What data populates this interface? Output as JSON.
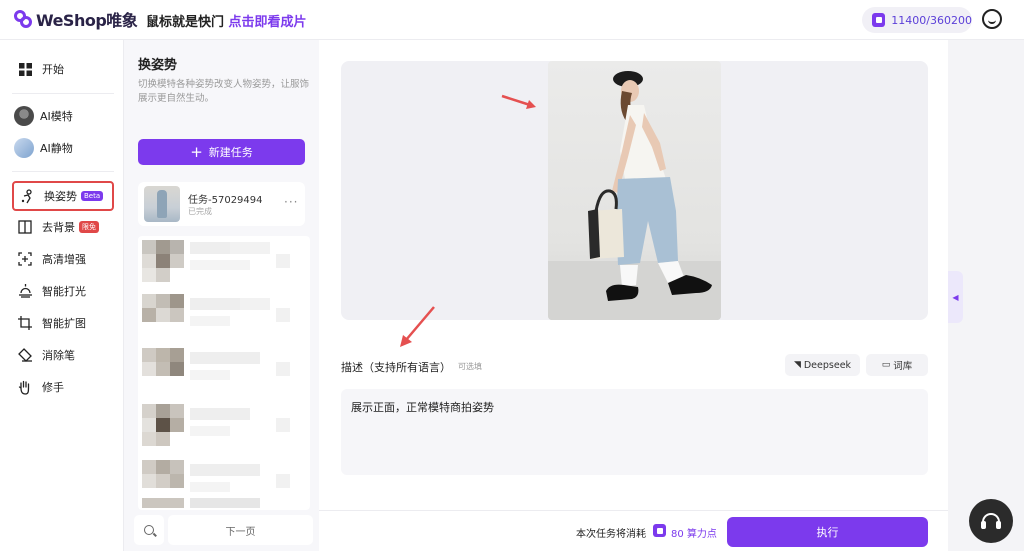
{
  "header": {
    "logo_text": "WeShop唯象",
    "slogan_prefix": "鼠标就是快门",
    "slogan_highlight": "点击即看成片",
    "credits": "11400/360200",
    "accent_color": "#7c3aed"
  },
  "nav": {
    "items": [
      {
        "label": "开始",
        "icon": "grid-icon"
      },
      {
        "label": "AI模特",
        "icon": "model-avatar"
      },
      {
        "label": "AI静物",
        "icon": "still-life-avatar"
      },
      {
        "label": "换姿势",
        "icon": "pose-icon",
        "badge": "Beta",
        "active": true
      },
      {
        "label": "去背景",
        "icon": "background-icon",
        "badge": "限免"
      },
      {
        "label": "高清增强",
        "icon": "enhance-icon"
      },
      {
        "label": "智能打光",
        "icon": "lighting-icon"
      },
      {
        "label": "智能扩图",
        "icon": "expand-icon"
      },
      {
        "label": "消除笔",
        "icon": "eraser-icon"
      },
      {
        "label": "修手",
        "icon": "hand-icon"
      }
    ]
  },
  "tasks": {
    "title": "换姿势",
    "description": "切换模特各种姿势改变人物姿势，让服饰展示更自然生动。",
    "new_task_label": "新建任务",
    "current": {
      "name": "任务-57029494",
      "status": "已完成",
      "more": "···"
    },
    "next_page_label": "下一页"
  },
  "main": {
    "description_label": "描述（支持所有语言）",
    "description_optional": "可选填",
    "deepseek_label": "Deepseek",
    "library_label": "词库",
    "description_value": "展示正面，正常模特商拍姿势",
    "cost_prefix": "本次任务将消耗",
    "cost_value": "80 算力点",
    "run_label": "执行"
  }
}
